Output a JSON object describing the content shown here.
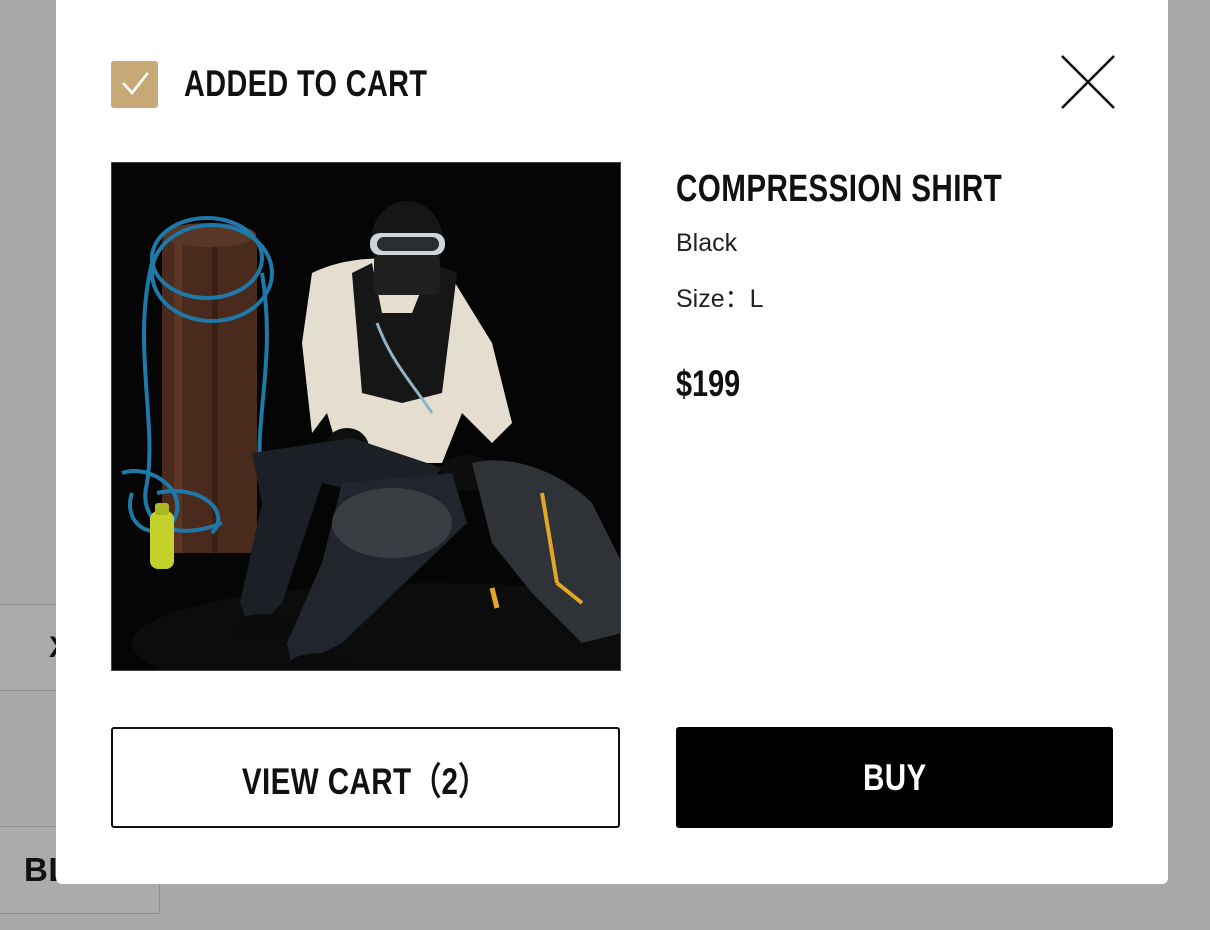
{
  "background": {
    "fragment_1": "X",
    "fragment_2": "BLACK"
  },
  "modal": {
    "title": "ADDED TO CART",
    "close_icon": "close-icon",
    "check_icon": "checkmark-icon",
    "accent_color": "#c8a876"
  },
  "product": {
    "name": "COMPRESSION SHIRT",
    "color": "Black",
    "size": "Size：L",
    "price": "$199",
    "image": "product-photo"
  },
  "actions": {
    "view_cart_label": "VIEW CART（2）",
    "buy_label": "BUY"
  }
}
